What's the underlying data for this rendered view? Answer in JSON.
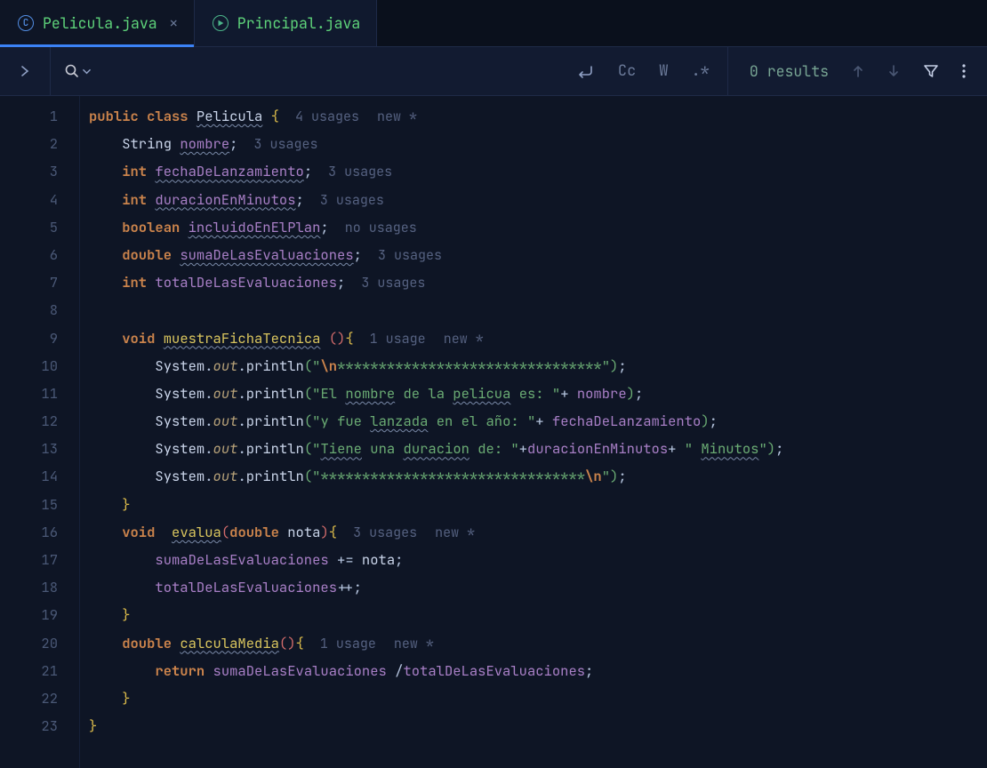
{
  "tabs": [
    {
      "label": "Pelicula.java",
      "iconLetter": "C",
      "active": true
    },
    {
      "label": "Principal.java",
      "iconPlay": true,
      "active": false
    }
  ],
  "searchbar": {
    "results": "0 results",
    "optCase": "Cc",
    "optWord": "W",
    "optRegex": ".*"
  },
  "highlightLine": 9,
  "lines": [
    {
      "n": 1,
      "indent": 0,
      "tokens": [
        {
          "t": "public ",
          "c": "kw"
        },
        {
          "t": "class ",
          "c": "kw"
        },
        {
          "t": "Pelicula",
          "c": "cls wavy"
        },
        {
          "t": " ",
          "c": ""
        },
        {
          "t": "{",
          "c": "p1"
        }
      ],
      "hints": [
        "4 usages",
        "new *"
      ]
    },
    {
      "n": 2,
      "indent": 1,
      "tokens": [
        {
          "t": "String ",
          "c": "id"
        },
        {
          "t": "nombre",
          "c": "fld wavy"
        },
        {
          "t": ";",
          "c": "op"
        }
      ],
      "hints": [
        "3 usages"
      ]
    },
    {
      "n": 3,
      "indent": 1,
      "tokens": [
        {
          "t": "int ",
          "c": "tp"
        },
        {
          "t": "fechaDeLanzamiento",
          "c": "fld wavy"
        },
        {
          "t": ";",
          "c": "op"
        }
      ],
      "hints": [
        "3 usages"
      ]
    },
    {
      "n": 4,
      "indent": 1,
      "tokens": [
        {
          "t": "int ",
          "c": "tp"
        },
        {
          "t": "duracionEnMinutos",
          "c": "fld wavy"
        },
        {
          "t": ";",
          "c": "op"
        }
      ],
      "hints": [
        "3 usages"
      ]
    },
    {
      "n": 5,
      "indent": 1,
      "tokens": [
        {
          "t": "boolean ",
          "c": "tp"
        },
        {
          "t": "incluidoEnElPlan",
          "c": "fld wavy"
        },
        {
          "t": ";",
          "c": "op"
        }
      ],
      "hints": [
        "no usages"
      ]
    },
    {
      "n": 6,
      "indent": 1,
      "tokens": [
        {
          "t": "double ",
          "c": "tp"
        },
        {
          "t": "sumaDeLasEvaluaciones",
          "c": "fld wavy"
        },
        {
          "t": ";",
          "c": "op"
        }
      ],
      "hints": [
        "3 usages"
      ]
    },
    {
      "n": 7,
      "indent": 1,
      "tokens": [
        {
          "t": "int ",
          "c": "tp"
        },
        {
          "t": "totalDeLasEvaluaciones",
          "c": "fld"
        },
        {
          "t": ";",
          "c": "op"
        }
      ],
      "hints": [
        "3 usages"
      ]
    },
    {
      "n": 8,
      "indent": 0,
      "tokens": [],
      "hints": []
    },
    {
      "n": 9,
      "indent": 1,
      "hl": true,
      "tokens": [
        {
          "t": "void ",
          "c": "tp"
        },
        {
          "t": "muestraFichaTecnica",
          "c": "mth wavy"
        },
        {
          "t": " ",
          "c": ""
        },
        {
          "t": "(",
          "c": "p2"
        },
        {
          "t": ")",
          "c": "p2"
        },
        {
          "t": "{",
          "c": "p1"
        }
      ],
      "hints": [
        "1 usage",
        "new *"
      ]
    },
    {
      "n": 10,
      "indent": 2,
      "tokens": [
        {
          "t": "System",
          "c": "id"
        },
        {
          "t": ".",
          "c": "op"
        },
        {
          "t": "out",
          "c": "stat"
        },
        {
          "t": ".",
          "c": "op"
        },
        {
          "t": "println",
          "c": "id"
        },
        {
          "t": "(",
          "c": "p3"
        },
        {
          "t": "\"",
          "c": "st"
        },
        {
          "t": "\\n",
          "c": "esc"
        },
        {
          "t": "********************************\"",
          "c": "st"
        },
        {
          "t": ")",
          "c": "p3"
        },
        {
          "t": ";",
          "c": "op"
        }
      ],
      "hints": []
    },
    {
      "n": 11,
      "indent": 2,
      "tokens": [
        {
          "t": "System",
          "c": "id"
        },
        {
          "t": ".",
          "c": "op"
        },
        {
          "t": "out",
          "c": "stat"
        },
        {
          "t": ".",
          "c": "op"
        },
        {
          "t": "println",
          "c": "id"
        },
        {
          "t": "(",
          "c": "p3"
        },
        {
          "t": "\"El ",
          "c": "st"
        },
        {
          "t": "nombre",
          "c": "st wavy"
        },
        {
          "t": " de la ",
          "c": "st"
        },
        {
          "t": "pelicua",
          "c": "st wavy"
        },
        {
          "t": " es: \"",
          "c": "st"
        },
        {
          "t": "+ ",
          "c": "op"
        },
        {
          "t": "nombre",
          "c": "fld"
        },
        {
          "t": ")",
          "c": "p3"
        },
        {
          "t": ";",
          "c": "op"
        }
      ],
      "hints": []
    },
    {
      "n": 12,
      "indent": 2,
      "tokens": [
        {
          "t": "System",
          "c": "id"
        },
        {
          "t": ".",
          "c": "op"
        },
        {
          "t": "out",
          "c": "stat"
        },
        {
          "t": ".",
          "c": "op"
        },
        {
          "t": "println",
          "c": "id"
        },
        {
          "t": "(",
          "c": "p3"
        },
        {
          "t": "\"y fue ",
          "c": "st"
        },
        {
          "t": "lanzada",
          "c": "st wavy"
        },
        {
          "t": " en el año: \"",
          "c": "st"
        },
        {
          "t": "+ ",
          "c": "op"
        },
        {
          "t": "fechaDeLanzamiento",
          "c": "fld"
        },
        {
          "t": ")",
          "c": "p3"
        },
        {
          "t": ";",
          "c": "op"
        }
      ],
      "hints": []
    },
    {
      "n": 13,
      "indent": 2,
      "tokens": [
        {
          "t": "System",
          "c": "id"
        },
        {
          "t": ".",
          "c": "op"
        },
        {
          "t": "out",
          "c": "stat"
        },
        {
          "t": ".",
          "c": "op"
        },
        {
          "t": "println",
          "c": "id"
        },
        {
          "t": "(",
          "c": "p3"
        },
        {
          "t": "\"",
          "c": "st"
        },
        {
          "t": "Tiene",
          "c": "st wavy"
        },
        {
          "t": " una ",
          "c": "st"
        },
        {
          "t": "duracion",
          "c": "st wavy"
        },
        {
          "t": " de: \"",
          "c": "st"
        },
        {
          "t": "+",
          "c": "op"
        },
        {
          "t": "duracionEnMinutos",
          "c": "fld"
        },
        {
          "t": "+ ",
          "c": "op"
        },
        {
          "t": "\" ",
          "c": "st"
        },
        {
          "t": "Minutos",
          "c": "st wavy"
        },
        {
          "t": "\"",
          "c": "st"
        },
        {
          "t": ")",
          "c": "p3"
        },
        {
          "t": ";",
          "c": "op"
        }
      ],
      "hints": []
    },
    {
      "n": 14,
      "indent": 2,
      "tokens": [
        {
          "t": "System",
          "c": "id"
        },
        {
          "t": ".",
          "c": "op"
        },
        {
          "t": "out",
          "c": "stat"
        },
        {
          "t": ".",
          "c": "op"
        },
        {
          "t": "println",
          "c": "id"
        },
        {
          "t": "(",
          "c": "p3"
        },
        {
          "t": "\"********************************",
          "c": "st"
        },
        {
          "t": "\\n",
          "c": "esc"
        },
        {
          "t": "\"",
          "c": "st"
        },
        {
          "t": ")",
          "c": "p3"
        },
        {
          "t": ";",
          "c": "op"
        }
      ],
      "hints": []
    },
    {
      "n": 15,
      "indent": 1,
      "tokens": [
        {
          "t": "}",
          "c": "p1"
        }
      ],
      "hints": []
    },
    {
      "n": 16,
      "indent": 1,
      "tokens": [
        {
          "t": "void  ",
          "c": "tp"
        },
        {
          "t": "evalua",
          "c": "mth wavy"
        },
        {
          "t": "(",
          "c": "p2"
        },
        {
          "t": "double ",
          "c": "tp"
        },
        {
          "t": "nota",
          "c": "id"
        },
        {
          "t": ")",
          "c": "p2"
        },
        {
          "t": "{",
          "c": "p1"
        }
      ],
      "hints": [
        "3 usages",
        "new *"
      ]
    },
    {
      "n": 17,
      "indent": 2,
      "tokens": [
        {
          "t": "sumaDeLasEvaluaciones ",
          "c": "fld"
        },
        {
          "t": "+= ",
          "c": "op"
        },
        {
          "t": "nota",
          "c": "id"
        },
        {
          "t": ";",
          "c": "op"
        }
      ],
      "hints": []
    },
    {
      "n": 18,
      "indent": 2,
      "tokens": [
        {
          "t": "totalDeLasEvaluaciones",
          "c": "fld"
        },
        {
          "t": "++;",
          "c": "op"
        }
      ],
      "hints": []
    },
    {
      "n": 19,
      "indent": 1,
      "tokens": [
        {
          "t": "}",
          "c": "p1"
        }
      ],
      "hints": []
    },
    {
      "n": 20,
      "indent": 1,
      "tokens": [
        {
          "t": "double ",
          "c": "tp"
        },
        {
          "t": "calculaMedia",
          "c": "mth wavy"
        },
        {
          "t": "(",
          "c": "p2"
        },
        {
          "t": ")",
          "c": "p2"
        },
        {
          "t": "{",
          "c": "p1"
        }
      ],
      "hints": [
        "1 usage",
        "new *"
      ]
    },
    {
      "n": 21,
      "indent": 2,
      "tokens": [
        {
          "t": "return ",
          "c": "kw"
        },
        {
          "t": "sumaDeLasEvaluaciones ",
          "c": "fld"
        },
        {
          "t": "/",
          "c": "op"
        },
        {
          "t": "totalDeLasEvaluaciones",
          "c": "fld"
        },
        {
          "t": ";",
          "c": "op"
        }
      ],
      "hints": []
    },
    {
      "n": 22,
      "indent": 1,
      "tokens": [
        {
          "t": "}",
          "c": "p1"
        }
      ],
      "hints": []
    },
    {
      "n": 23,
      "indent": 0,
      "tokens": [
        {
          "t": "}",
          "c": "p4"
        }
      ],
      "hints": []
    }
  ]
}
